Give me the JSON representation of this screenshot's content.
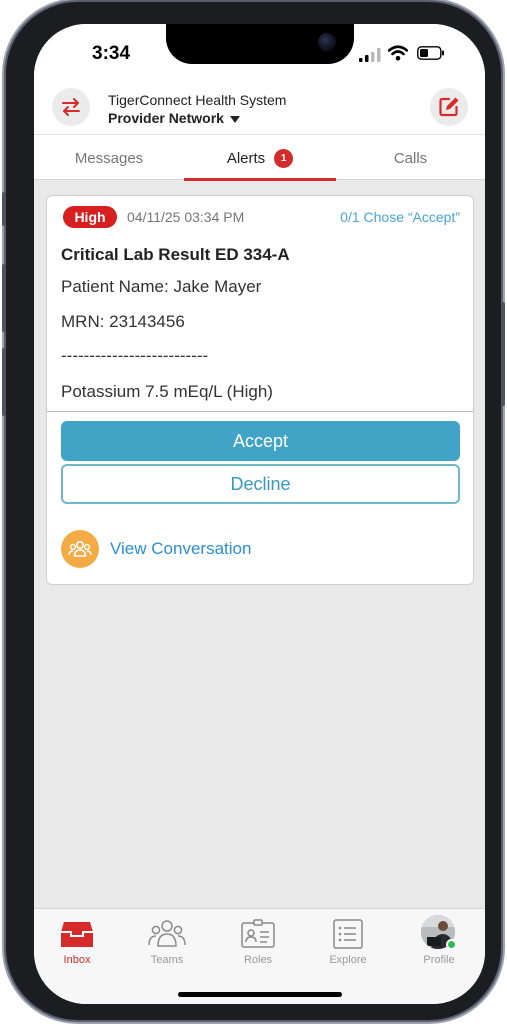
{
  "status_bar": {
    "time": "3:34"
  },
  "header": {
    "organization": "TigerConnect Health System",
    "network": "Provider Network"
  },
  "tabs": [
    {
      "label": "Messages"
    },
    {
      "label": "Alerts",
      "badge": "1"
    },
    {
      "label": "Calls"
    }
  ],
  "alert": {
    "priority": "High",
    "datetime": "04/11/25 03:34 PM",
    "response_status": "0/1 Chose “Accept”",
    "title": "Critical Lab Result ED 334-A",
    "patient": "Patient Name: Jake Mayer",
    "mrn": "MRN: 23143456",
    "separator": "--------------------------",
    "result": "Potassium 7.5 mEq/L (High)",
    "accept_label": "Accept",
    "decline_label": "Decline",
    "view_conversation": "View Conversation"
  },
  "bottom_nav": [
    {
      "label": "Inbox",
      "icon": "inbox-icon"
    },
    {
      "label": "Teams",
      "icon": "teams-icon"
    },
    {
      "label": "Roles",
      "icon": "roles-icon"
    },
    {
      "label": "Explore",
      "icon": "explore-icon"
    },
    {
      "label": "Profile",
      "icon": "avatar"
    }
  ],
  "colors": {
    "accent_red": "#d52b2b",
    "accept_blue": "#41a3c6",
    "link_blue": "#2c8fd1",
    "conversation_orange": "#f3ab45"
  }
}
